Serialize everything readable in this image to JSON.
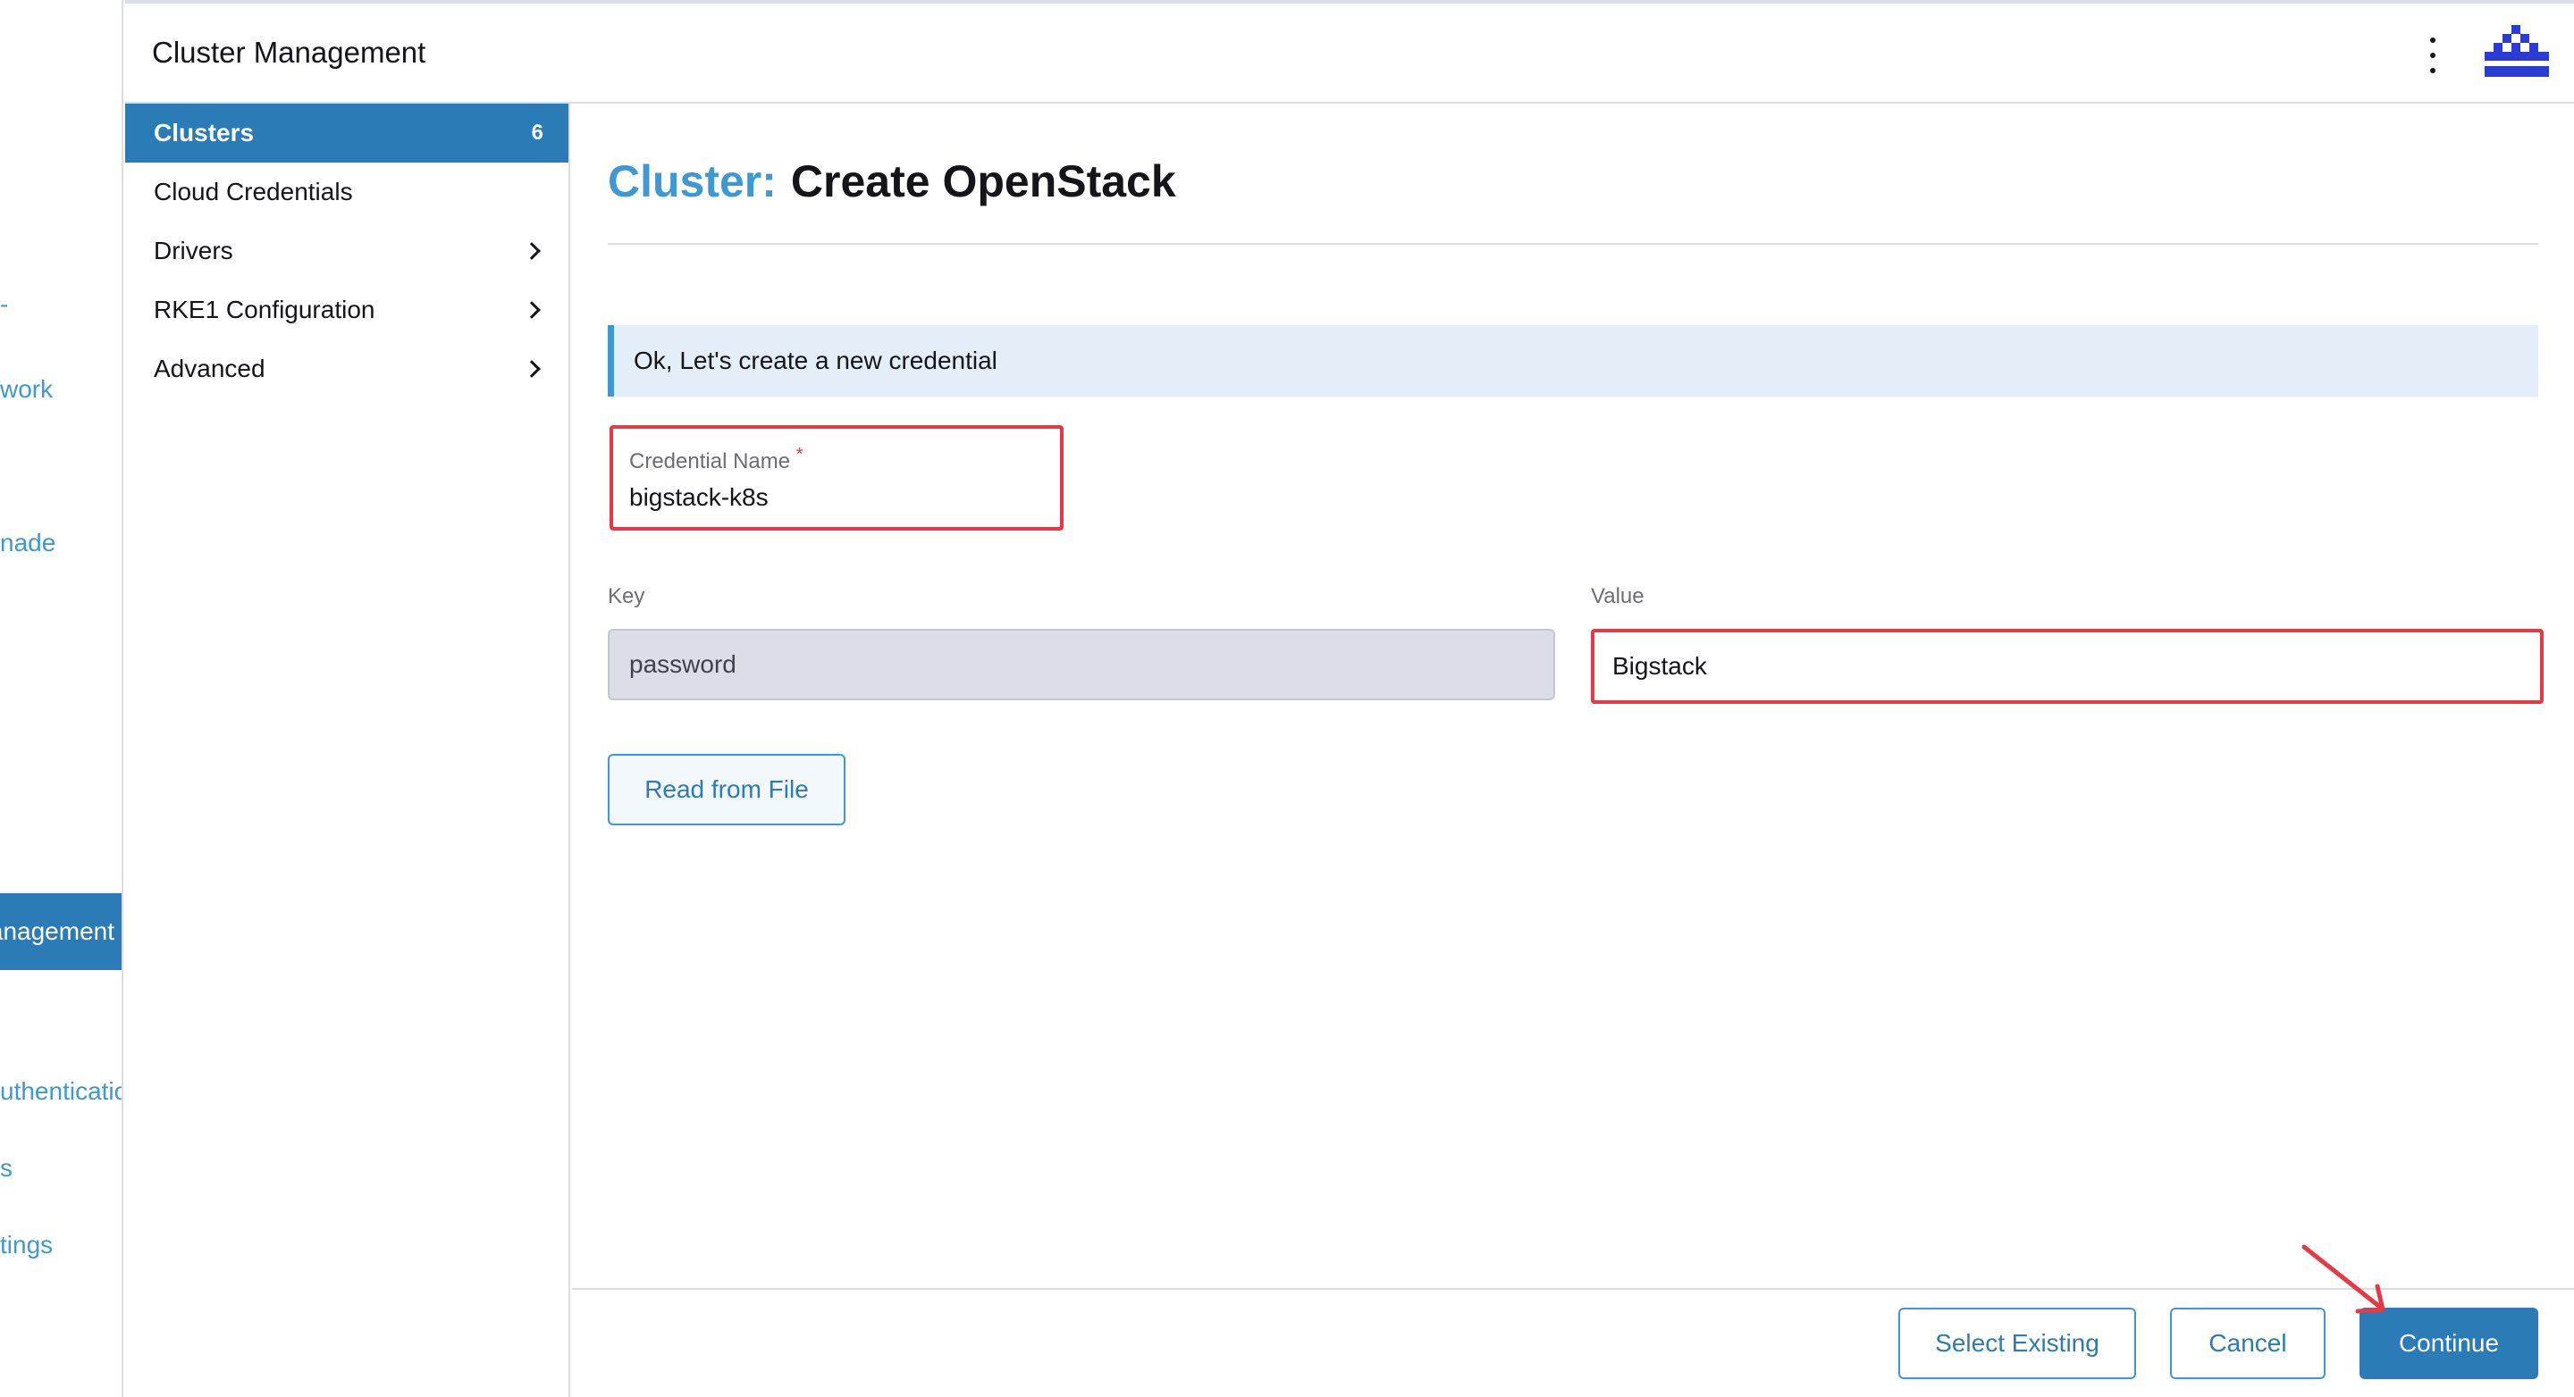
{
  "global_nav": {
    "items": [
      {
        "label": "work"
      },
      {
        "label": "nade"
      },
      {
        "label": "uthenticatio"
      },
      {
        "label": "s"
      },
      {
        "label": "tings"
      }
    ],
    "active_label": "anagement"
  },
  "header": {
    "title": "Cluster Management"
  },
  "sidebar": {
    "items": [
      {
        "label": "Clusters",
        "count": "6",
        "active": true
      },
      {
        "label": "Cloud Credentials"
      },
      {
        "label": "Drivers"
      },
      {
        "label": "RKE1 Configuration"
      },
      {
        "label": "Advanced"
      }
    ]
  },
  "page": {
    "title_prefix": "Cluster:",
    "title": "Create OpenStack",
    "banner": "Ok, Let's create a new credential",
    "credential_name": {
      "label": "Credential Name",
      "required_mark": "*",
      "value": "bigstack-k8s"
    },
    "key_label": "Key",
    "key_value": "password",
    "value_label": "Value",
    "value_value": "Bigstack",
    "read_file_button": "Read from File"
  },
  "footer": {
    "select_existing": "Select Existing",
    "cancel": "Cancel",
    "continue": "Continue"
  },
  "colors": {
    "accent": "#3d98d3",
    "primary": "#2a7bb6",
    "highlight": "#e63946"
  }
}
